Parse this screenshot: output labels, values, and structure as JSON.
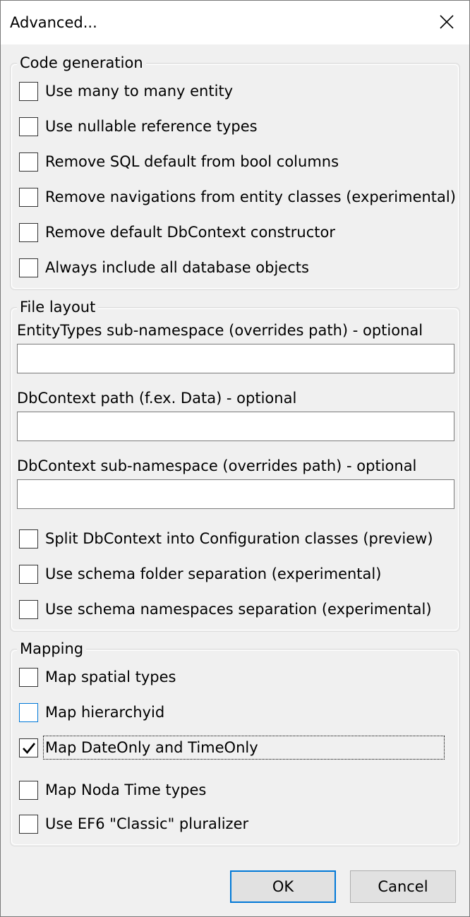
{
  "window": {
    "title": "Advanced..."
  },
  "code_generation": {
    "legend": "Code generation",
    "options": [
      {
        "label": "Use many to many entity",
        "checked": false
      },
      {
        "label": "Use nullable reference types",
        "checked": false
      },
      {
        "label": "Remove SQL default from bool columns",
        "checked": false
      },
      {
        "label": "Remove navigations from entity classes (experimental)",
        "checked": false
      },
      {
        "label": "Remove default DbContext constructor",
        "checked": false
      },
      {
        "label": "Always include all database objects",
        "checked": false
      }
    ]
  },
  "file_layout": {
    "legend": "File layout",
    "fields": [
      {
        "label": "EntityTypes sub-namespace (overrides path) - optional",
        "value": ""
      },
      {
        "label": "DbContext path (f.ex. Data) - optional",
        "value": ""
      },
      {
        "label": "DbContext sub-namespace (overrides path) - optional",
        "value": ""
      }
    ],
    "options": [
      {
        "label": "Split DbContext into Configuration classes (preview)",
        "checked": false
      },
      {
        "label": "Use schema folder separation (experimental)",
        "checked": false
      },
      {
        "label": "Use schema namespaces separation (experimental)",
        "checked": false
      }
    ]
  },
  "mapping": {
    "legend": "Mapping",
    "options": [
      {
        "label": "Map spatial types",
        "checked": false
      },
      {
        "label": "Map hierarchyid",
        "checked": false,
        "hovered": true
      },
      {
        "label": "Map DateOnly and TimeOnly",
        "checked": true,
        "focused": true
      },
      {
        "label": "Map Noda Time types",
        "checked": false
      },
      {
        "label": "Use EF6 \"Classic\" pluralizer",
        "checked": false
      }
    ]
  },
  "buttons": {
    "ok": "OK",
    "cancel": "Cancel"
  },
  "icons": {
    "close": "close-icon",
    "check": "checkmark-icon"
  }
}
